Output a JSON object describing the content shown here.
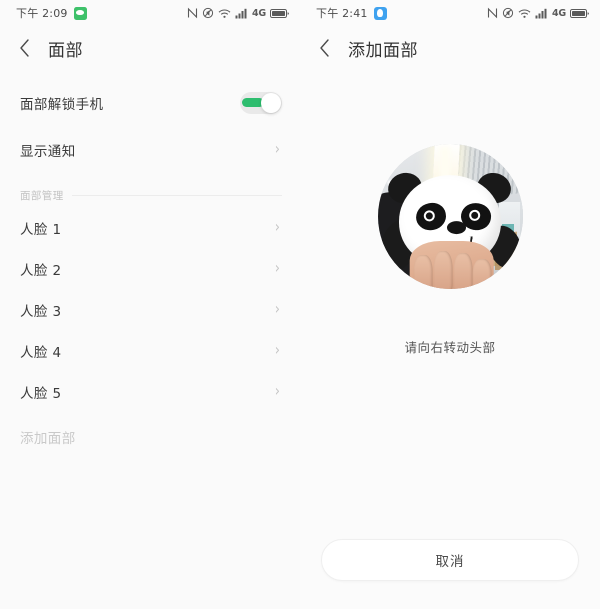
{
  "left_screen": {
    "status_bar": {
      "time": "下午 2:09",
      "app_icon": "wechat-icon",
      "icons": [
        "nfc-icon",
        "mute-icon",
        "wifi-icon",
        "signal-icon",
        "battery-icon"
      ],
      "network_label": "4G"
    },
    "title": "面部",
    "back_icon": "back-chevron-icon",
    "face_unlock": {
      "label": "面部解锁手机",
      "toggle_state": "on",
      "toggle_color": "#2dbd6e"
    },
    "show_notifications": {
      "label": "显示通知",
      "chevron": "›"
    },
    "section_header": "面部管理",
    "faces": [
      {
        "label": "人脸 1",
        "chevron": "›"
      },
      {
        "label": "人脸 2",
        "chevron": "›"
      },
      {
        "label": "人脸 3",
        "chevron": "›"
      },
      {
        "label": "人脸 4",
        "chevron": "›"
      },
      {
        "label": "人脸 5",
        "chevron": "›"
      }
    ],
    "add_face": {
      "label": "添加面部",
      "state": "disabled"
    }
  },
  "right_screen": {
    "status_bar": {
      "time": "下午 2:41",
      "app_icon": "qq-icon",
      "icons": [
        "nfc-icon",
        "mute-icon",
        "wifi-icon",
        "signal-icon",
        "battery-icon"
      ],
      "network_label": "4G"
    },
    "title": "添加面部",
    "back_icon": "back-chevron-icon",
    "preview": {
      "description": "camera-preview-circle",
      "subject": "panda-plush-toy-held-in-hand"
    },
    "instruction": "请向右转动头部",
    "cancel_button": "取消"
  }
}
